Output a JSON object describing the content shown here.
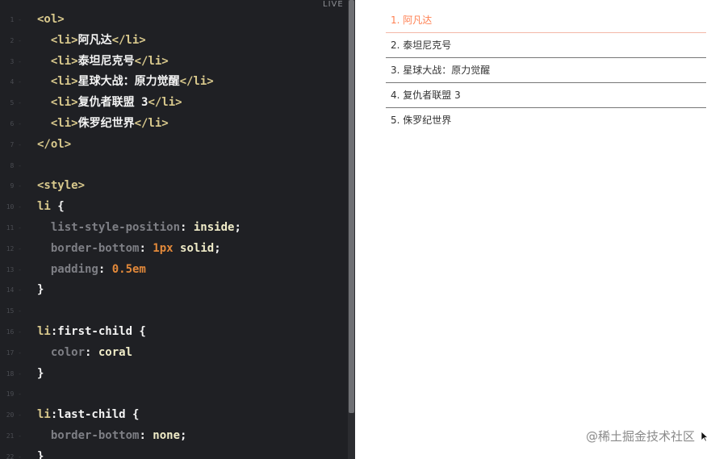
{
  "editor": {
    "live_badge": "LIVE",
    "lines": [
      {
        "n": "1",
        "parts": [
          {
            "t": "<ol>",
            "c": "tag"
          }
        ]
      },
      {
        "n": "2",
        "parts": [
          {
            "t": "  ",
            "c": "text"
          },
          {
            "t": "<li>",
            "c": "tag"
          },
          {
            "t": "阿凡达",
            "c": "text"
          },
          {
            "t": "</li>",
            "c": "tag"
          }
        ]
      },
      {
        "n": "3",
        "parts": [
          {
            "t": "  ",
            "c": "text"
          },
          {
            "t": "<li>",
            "c": "tag"
          },
          {
            "t": "泰坦尼克号",
            "c": "text"
          },
          {
            "t": "</li>",
            "c": "tag"
          }
        ]
      },
      {
        "n": "4",
        "parts": [
          {
            "t": "  ",
            "c": "text"
          },
          {
            "t": "<li>",
            "c": "tag"
          },
          {
            "t": "星球大战：原力觉醒",
            "c": "text"
          },
          {
            "t": "</li>",
            "c": "tag"
          }
        ]
      },
      {
        "n": "5",
        "parts": [
          {
            "t": "  ",
            "c": "text"
          },
          {
            "t": "<li>",
            "c": "tag"
          },
          {
            "t": "复仇者联盟 3",
            "c": "text"
          },
          {
            "t": "</li>",
            "c": "tag"
          }
        ]
      },
      {
        "n": "6",
        "parts": [
          {
            "t": "  ",
            "c": "text"
          },
          {
            "t": "<li>",
            "c": "tag"
          },
          {
            "t": "侏罗纪世界",
            "c": "text"
          },
          {
            "t": "</li>",
            "c": "tag"
          }
        ]
      },
      {
        "n": "7",
        "parts": [
          {
            "t": "</ol>",
            "c": "tag"
          }
        ]
      },
      {
        "n": "8",
        "parts": []
      },
      {
        "n": "9",
        "parts": [
          {
            "t": "<style>",
            "c": "tag"
          }
        ]
      },
      {
        "n": "10",
        "parts": [
          {
            "t": "li",
            "c": "sel"
          },
          {
            "t": " {",
            "c": "text"
          }
        ]
      },
      {
        "n": "11",
        "parts": [
          {
            "t": "  list-style-position",
            "c": "prop"
          },
          {
            "t": ": ",
            "c": "text"
          },
          {
            "t": "inside",
            "c": "val"
          },
          {
            "t": ";",
            "c": "text"
          }
        ]
      },
      {
        "n": "12",
        "parts": [
          {
            "t": "  border-bottom",
            "c": "prop"
          },
          {
            "t": ": ",
            "c": "text"
          },
          {
            "t": "1px",
            "c": "num"
          },
          {
            "t": " ",
            "c": "text"
          },
          {
            "t": "solid",
            "c": "val"
          },
          {
            "t": ";",
            "c": "text"
          }
        ]
      },
      {
        "n": "13",
        "parts": [
          {
            "t": "  padding",
            "c": "prop"
          },
          {
            "t": ": ",
            "c": "text"
          },
          {
            "t": "0.5em",
            "c": "num"
          }
        ]
      },
      {
        "n": "14",
        "parts": [
          {
            "t": "}",
            "c": "text"
          }
        ]
      },
      {
        "n": "15",
        "parts": []
      },
      {
        "n": "16",
        "parts": [
          {
            "t": "li",
            "c": "sel"
          },
          {
            "t": ":first-child {",
            "c": "text"
          }
        ]
      },
      {
        "n": "17",
        "parts": [
          {
            "t": "  color",
            "c": "prop"
          },
          {
            "t": ": ",
            "c": "text"
          },
          {
            "t": "coral",
            "c": "val"
          }
        ]
      },
      {
        "n": "18",
        "parts": [
          {
            "t": "}",
            "c": "text"
          }
        ]
      },
      {
        "n": "19",
        "parts": []
      },
      {
        "n": "20",
        "parts": [
          {
            "t": "li",
            "c": "sel"
          },
          {
            "t": ":last-child {",
            "c": "text"
          }
        ]
      },
      {
        "n": "21",
        "parts": [
          {
            "t": "  border-bottom",
            "c": "prop"
          },
          {
            "t": ": ",
            "c": "text"
          },
          {
            "t": "none",
            "c": "val"
          },
          {
            "t": ";",
            "c": "text"
          }
        ]
      },
      {
        "n": "22",
        "parts": [
          {
            "t": "}",
            "c": "text"
          }
        ]
      }
    ]
  },
  "preview": {
    "items": [
      {
        "label": "1. 阿凡达"
      },
      {
        "label": "2. 泰坦尼克号"
      },
      {
        "label": "3. 星球大战：原力觉醒"
      },
      {
        "label": "4. 复仇者联盟 3"
      },
      {
        "label": "5. 侏罗纪世界"
      }
    ],
    "first_item_color": "coral"
  },
  "watermark": "@稀土掘金技术社区",
  "colors": {
    "editor_bg": "#1f2024",
    "tag": "#d9c98d",
    "number": "#e3893a",
    "property": "#7e7f85",
    "accent": "coral"
  },
  "icons": {
    "cursor": "mouse-pointer-icon"
  }
}
